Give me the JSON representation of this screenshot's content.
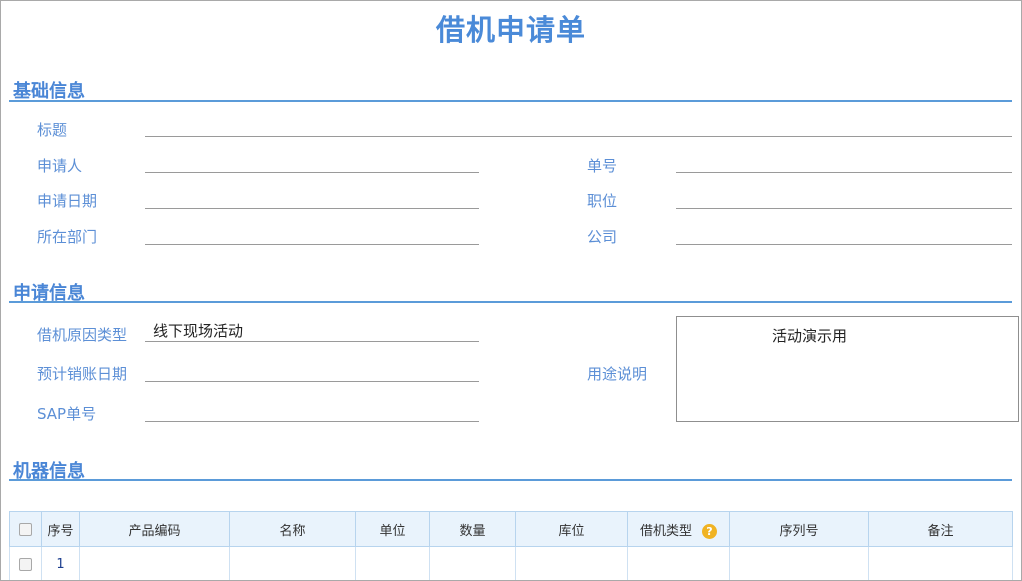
{
  "form": {
    "title": "借机申请单"
  },
  "basic": {
    "heading": "基础信息",
    "title_label": "标题",
    "applicant_label": "申请人",
    "order_no_label": "单号",
    "apply_date_label": "申请日期",
    "position_label": "职位",
    "department_label": "所在部门",
    "company_label": "公司"
  },
  "apply": {
    "heading": "申请信息",
    "reason_type_label": "借机原因类型",
    "reason_type_value": "线下现场活动",
    "write_off_date_label": "预计销账日期",
    "usage_label": "用途说明",
    "usage_value": "活动演示用",
    "sap_label": "SAP单号"
  },
  "machine": {
    "heading": "机器信息",
    "columns": [
      "序号",
      "产品编码",
      "名称",
      "单位",
      "数量",
      "库位",
      "借机类型",
      "序列号",
      "备注"
    ],
    "help_icon": "?",
    "rows": [
      {
        "index": "1"
      }
    ]
  }
}
